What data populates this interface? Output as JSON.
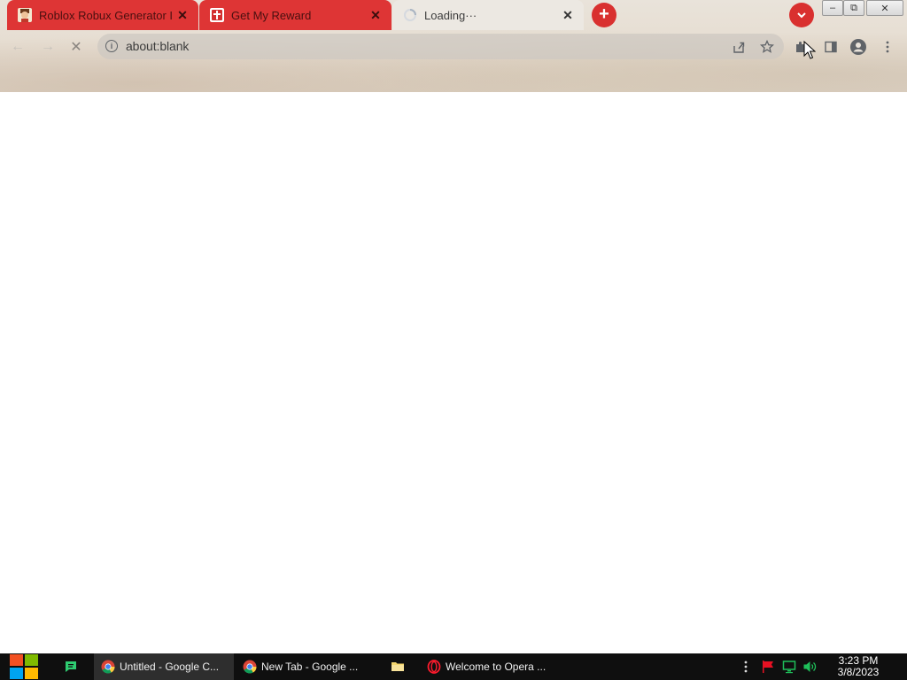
{
  "browser": {
    "tabs": [
      {
        "title": "Roblox Robux Generator I",
        "favicon": "roblox-avatar-icon",
        "state": "background"
      },
      {
        "title": "Get My Reward",
        "favicon": "reward-gift-icon",
        "state": "background"
      },
      {
        "title": "Loading···",
        "favicon": "loading-spinner-icon",
        "state": "active"
      }
    ],
    "tab_close_glyph": "✕",
    "new_tab_glyph": "+",
    "window_controls": {
      "minimize": "–",
      "maximize": "⧉",
      "close": "✕"
    },
    "address_bar": {
      "url": "about:blank",
      "info_glyph": "i"
    },
    "nav_glyphs": {
      "back": "←",
      "forward": "→",
      "stop": "✕"
    },
    "colors": {
      "accent_red": "#de3535",
      "active_tab": "#ece8e2"
    }
  },
  "taskbar": {
    "apps": [
      {
        "label": "Untitled - Google C...",
        "icon": "chrome-icon",
        "selected": true
      },
      {
        "label": "New Tab - Google ...",
        "icon": "chrome-icon",
        "selected": false
      },
      {
        "label": "",
        "icon": "file-explorer-icon",
        "selected": false
      },
      {
        "label": "Welcome to Opera ...",
        "icon": "opera-icon",
        "selected": false
      }
    ],
    "clock": {
      "time": "3:23 PM",
      "date": "3/8/2023"
    }
  }
}
